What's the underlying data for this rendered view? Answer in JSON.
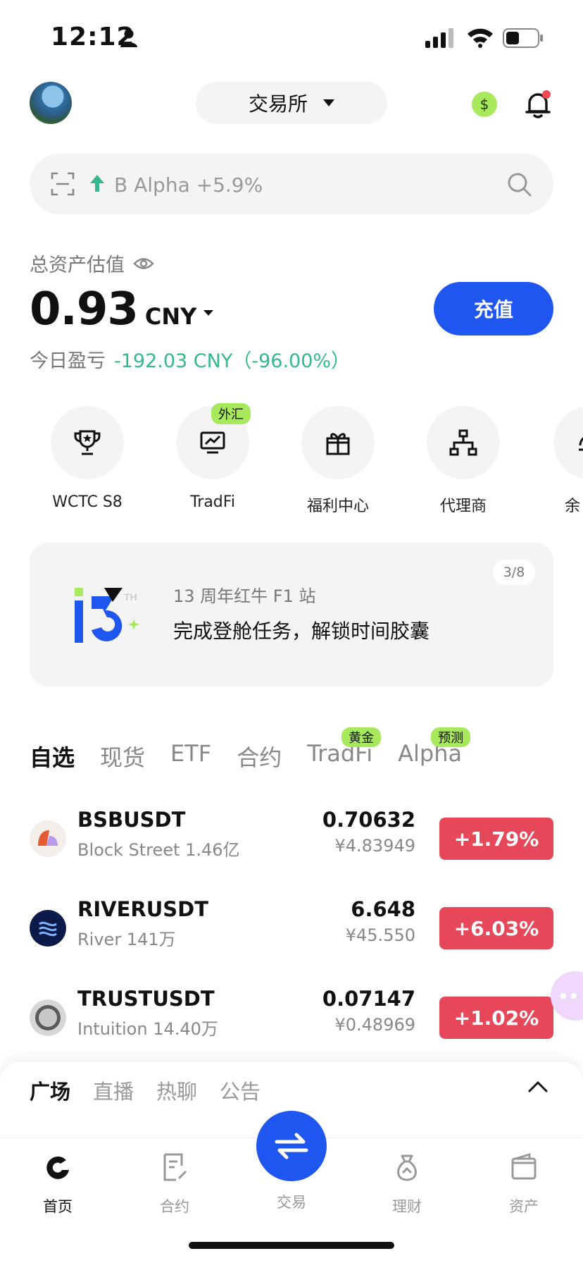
{
  "status_bar": {
    "time": "12:12"
  },
  "header": {
    "exchange_label": "交易所"
  },
  "search": {
    "hint": "B Alpha +5.9%"
  },
  "assets": {
    "label": "总资产估值",
    "value": "0.93",
    "unit": "CNY",
    "deposit_label": "充值",
    "pnl_label": "今日盈亏",
    "pnl_value": "-192.03 CNY（-96.00%）"
  },
  "shortcuts": [
    {
      "label": "WCTC S8",
      "icon": "trophy-icon"
    },
    {
      "label": "TradFi",
      "icon": "chart-monitor-icon",
      "badge": "外汇"
    },
    {
      "label": "福利中心",
      "icon": "gift-icon"
    },
    {
      "label": "代理商",
      "icon": "org-chart-icon"
    },
    {
      "label": "余",
      "icon": "partial-icon"
    }
  ],
  "banner": {
    "subtitle": "13 周年红牛 F1 站",
    "title": "完成登舱任务，解锁时间胶囊",
    "page": "3/8",
    "logo_text": "13",
    "logo_sup": "TH"
  },
  "market_tabs": [
    {
      "label": "自选",
      "active": true
    },
    {
      "label": "现货"
    },
    {
      "label": "ETF"
    },
    {
      "label": "合约"
    },
    {
      "label": "TradFi",
      "badge": "黄金"
    },
    {
      "label": "Alpha",
      "badge": "预测"
    }
  ],
  "market_rows": [
    {
      "pair": "BSBUSDT",
      "name": "Block Street",
      "volume": "1.46亿",
      "price": "0.70632",
      "fiat": "¥4.83949",
      "change": "+1.79%"
    },
    {
      "pair": "RIVERUSDT",
      "name": "River",
      "volume": "141万",
      "price": "6.648",
      "fiat": "¥45.550",
      "change": "+6.03%"
    },
    {
      "pair": "TRUSTUSDT",
      "name": "Intuition",
      "volume": "14.40万",
      "price": "0.07147",
      "fiat": "¥0.48969",
      "change": "+1.02%"
    }
  ],
  "feed_tabs": [
    {
      "label": "广场",
      "active": true
    },
    {
      "label": "直播"
    },
    {
      "label": "热聊"
    },
    {
      "label": "公告"
    }
  ],
  "bottom_nav": [
    {
      "label": "首页",
      "icon": "home-icon",
      "active": true
    },
    {
      "label": "合约",
      "icon": "contract-icon"
    },
    {
      "label": "交易",
      "icon": "swap-icon"
    },
    {
      "label": "理财",
      "icon": "money-bag-icon"
    },
    {
      "label": "资产",
      "icon": "wallet-icon"
    }
  ],
  "colors": {
    "accent": "#1f56f0",
    "positive": "#35b890",
    "change_bg": "#e6485a",
    "badge": "#a8e85c"
  }
}
